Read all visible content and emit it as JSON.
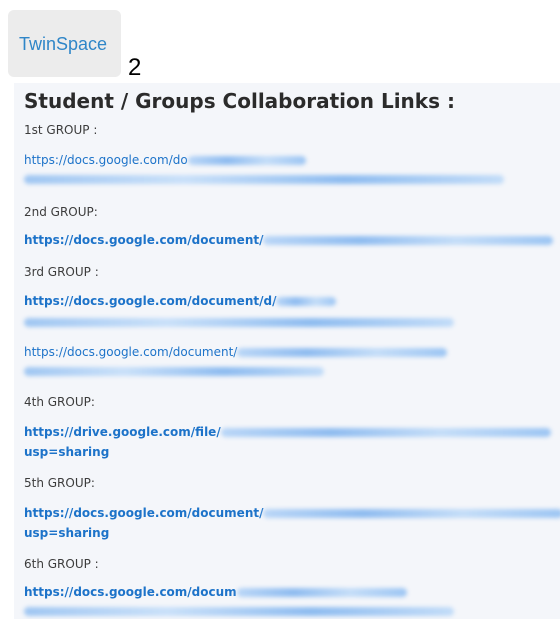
{
  "header": {
    "logo_text": "TwinSpace",
    "counter": "2"
  },
  "document": {
    "title": "Student / Groups  Collaboration Links :",
    "groups": [
      {
        "label": "1st GROUP :",
        "links": [
          "https://docs.google.com/do"
        ]
      },
      {
        "label": "2nd GROUP:",
        "links": [
          "https://docs.google.com/document/"
        ]
      },
      {
        "label": "3rd GROUP :",
        "links": [
          "https://docs.google.com/document/d/",
          "https://docs.google.com/document/"
        ]
      },
      {
        "label": "4th GROUP:",
        "links": [
          "https://drive.google.com/file/"
        ],
        "suffix": "usp=sharing"
      },
      {
        "label": "5th GROUP:",
        "links": [
          "https://docs.google.com/document/"
        ],
        "suffix": "usp=sharing"
      },
      {
        "label": "6th GROUP :",
        "links": [
          "https://docs.google.com/docum"
        ]
      }
    ]
  }
}
